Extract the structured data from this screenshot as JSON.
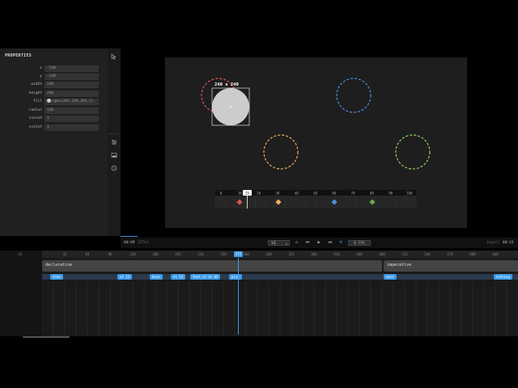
{
  "properties": {
    "title": "PROPERTIES",
    "rows": [
      {
        "label": "x",
        "value": "-540"
      },
      {
        "label": "y",
        "value": "-220"
      },
      {
        "label": "width",
        "value": "240"
      },
      {
        "label": "height",
        "value": "240"
      },
      {
        "label": "fill",
        "value": "rgba(204,204,204,1)"
      },
      {
        "label": "radius",
        "value": "120"
      },
      {
        "label": "scaleX",
        "value": "1"
      },
      {
        "label": "scaleY",
        "value": "1"
      }
    ],
    "fill_color": "#cccccc"
  },
  "rail_icons": [
    "pointer-icon",
    "sliders-icon",
    "image-icon",
    "clock-icon"
  ],
  "stage": {
    "selection_label": "240 x 240",
    "circle_colors": {
      "red": "#e05555",
      "blue": "#4a90e2",
      "orange": "#f0b060",
      "green": "#8fd16a"
    },
    "mini_timeline": {
      "ticks": [
        "0",
        "10",
        "20",
        "30",
        "40",
        "50",
        "60",
        "70",
        "80",
        "90",
        "100"
      ],
      "playhead_label": "25",
      "keyframe_colors": [
        "#e05555",
        "#f0b060",
        "#4a90e2",
        "#6ab04c"
      ]
    }
  },
  "transport": {
    "time": "00:09",
    "percent": "[27%]",
    "speed": "x1",
    "fps": "0 FPS",
    "status": "(sync)",
    "duration": "00:43"
  },
  "timeline": {
    "start_label": "-32",
    "ruler": [
      "32",
      "64",
      "96",
      "128",
      "160",
      "192",
      "224",
      "256",
      "288",
      "320",
      "352",
      "384",
      "416",
      "448",
      "480",
      "512",
      "544",
      "576",
      "608",
      "640"
    ],
    "playhead_label": "272",
    "tracks": [
      {
        "label": "declarative"
      },
      {
        "label": "imperative"
      }
    ],
    "chips": [
      "show",
      "ot 13",
      "base",
      "ot 14",
      "that_ot ot 03",
      "play",
      "move",
      "nothing"
    ]
  },
  "colors": {
    "accent": "#3d9be9",
    "panel": "#202020",
    "stage": "#1e1e1e"
  }
}
